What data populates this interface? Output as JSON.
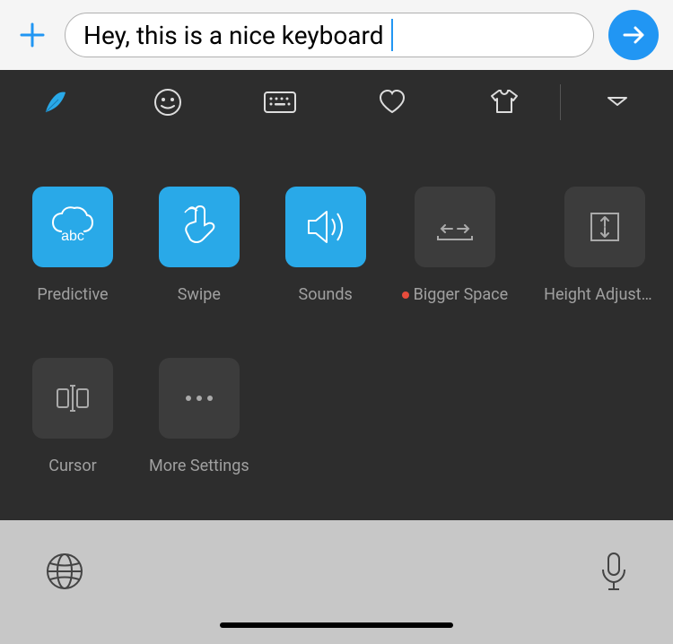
{
  "input": {
    "text": "Hey, this is a nice keyboard"
  },
  "settings": {
    "items": [
      {
        "label": "Predictive",
        "active": true
      },
      {
        "label": "Swipe",
        "active": true
      },
      {
        "label": "Sounds",
        "active": true
      },
      {
        "label": "Bigger Space",
        "active": false,
        "hasDot": true
      },
      {
        "label": "Height Adjustme…",
        "active": false
      },
      {
        "label": "Cursor",
        "active": false
      },
      {
        "label": "More Settings",
        "active": false
      }
    ]
  }
}
